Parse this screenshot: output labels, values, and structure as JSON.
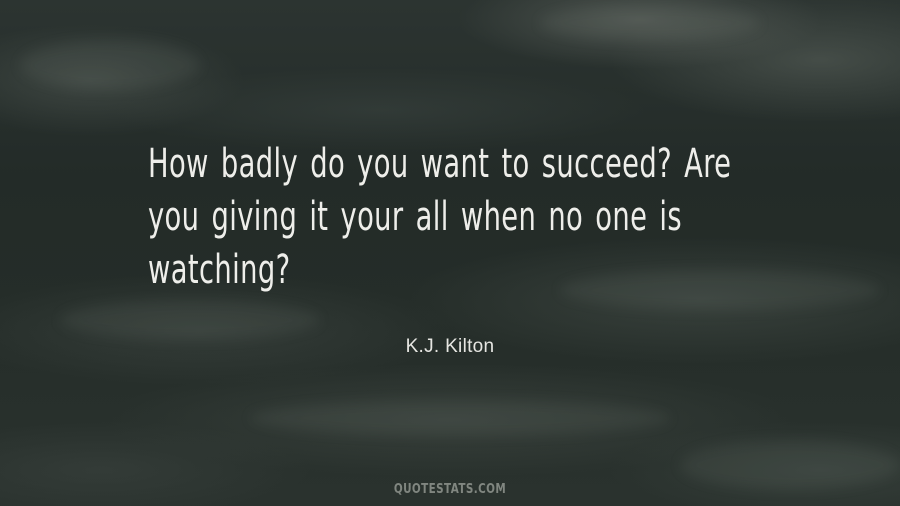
{
  "quote": {
    "lines": [
      "How badly do you want to succeed? Are",
      "you giving it your all when no one is",
      "watching?"
    ]
  },
  "author": "K.J. Kilton",
  "watermark": "QUOTESTATS.COM"
}
